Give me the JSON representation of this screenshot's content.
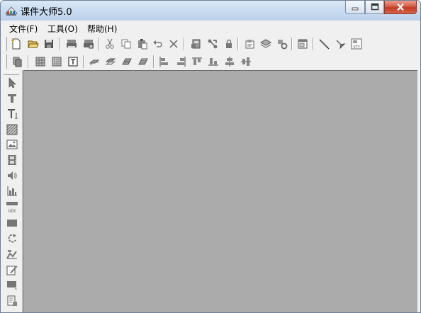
{
  "window": {
    "title": "课件大师5.0",
    "icon": "app-logo-icon"
  },
  "window_controls": [
    "minimize-icon",
    "maximize-icon",
    "close-icon"
  ],
  "menu": {
    "items": [
      {
        "label": "文件(F)"
      },
      {
        "label": "工具(O)"
      },
      {
        "label": "帮助(H)"
      }
    ]
  },
  "toolbar_top": [
    "new-file-icon",
    "open-folder-icon",
    "save-icon",
    "sep",
    "print-icon",
    "print-preview-icon",
    "sep",
    "cut-icon",
    "copy-icon",
    "paste-icon",
    "undo-icon",
    "delete-icon",
    "sep",
    "import-icon",
    "link-icon",
    "lock-icon",
    "sep",
    "properties-icon",
    "layers-icon",
    "settings-icon",
    "sep",
    "window-icon",
    "sep",
    "pen-icon",
    "brush-icon",
    "style-icon"
  ],
  "toolbar_bottom": [
    "page-icon",
    "sep",
    "grid-icon",
    "grid-fine-icon",
    "text-frame-icon",
    "sep",
    "layer-up-icon",
    "layer-down-icon",
    "layer-top-icon",
    "layer-bottom-icon",
    "sep",
    "align-left-icon",
    "align-right-icon",
    "align-top-icon",
    "align-bottom-icon",
    "align-center-v-icon",
    "align-center-h-icon"
  ],
  "palette": {
    "tools": [
      "pointer-icon",
      "text-t-icon",
      "text-t2-icon",
      "pattern-icon",
      "image-icon",
      "film-icon",
      "sound-icon",
      "chart-icon",
      "index-icon",
      "rectangle-icon",
      "rotate-icon",
      "effects-icon",
      "edit-icon",
      "comment-icon",
      "document-icon"
    ],
    "index_label": "idX"
  },
  "colors": {
    "titlebar": "#c9dcf1",
    "menubar": "#f0f0f0",
    "canvas": "#ababab",
    "close_button": "#c9462c"
  }
}
